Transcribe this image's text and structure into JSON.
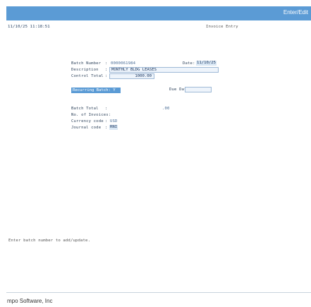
{
  "header": {
    "action_label": "Enter/Edit"
  },
  "screen": {
    "timestamp": "11/10/25 11:18:51",
    "title": "Invoice Entry"
  },
  "form": {
    "batch_number_label": "Batch Number",
    "batch_number_sep": ":",
    "batch_number": "0000061984",
    "date_label": "Date:",
    "date": "11/10/25",
    "description_label": "Description",
    "description_sep": ":",
    "description": "MONTHLY BLDG LEASES",
    "control_total_label": "Control Total",
    "control_total_sep": ":",
    "control_total": "1000.00",
    "recurring_batch_label": "Recurring Batch: Y",
    "due_date_label": "Due Date:",
    "due_date": "",
    "batch_total_label": "Batch Total",
    "batch_total_sep": ":",
    "batch_total": ".00",
    "no_invoices_label": "No. of Invoices:",
    "currency_code_label": "Currency code",
    "currency_code_sep": ":",
    "currency_code": "USD",
    "journal_code_label": "Journal code",
    "journal_code_sep": ":",
    "journal_code": "RNI"
  },
  "status_message": "Enter batch number to add/update.",
  "footer": {
    "company": "mpo Software, Inc"
  },
  "colors": {
    "accent": "#5b9bd5",
    "field_bg": "#eef4fb",
    "text": "#1f3550"
  }
}
